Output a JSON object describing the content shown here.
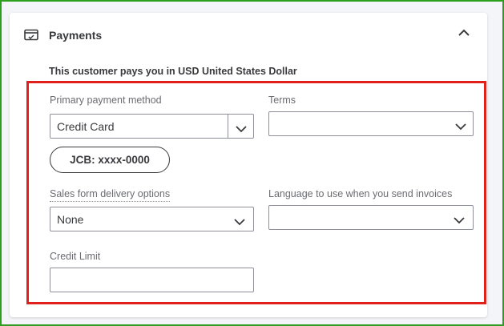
{
  "section": {
    "title": "Payments",
    "icon": "payment-card-icon",
    "collapse_icon": "chevron-up-icon"
  },
  "currency_note": "This customer pays you in USD United States Dollar",
  "fields": {
    "primary_payment_method": {
      "label": "Primary payment method",
      "value": "Credit Card"
    },
    "terms": {
      "label": "Terms",
      "value": ""
    },
    "saved_card": {
      "label": "JCB: xxxx-0000"
    },
    "sales_form_delivery": {
      "label": "Sales form delivery options",
      "value": "None"
    },
    "invoice_language": {
      "label": "Language to use when you send invoices",
      "value": ""
    },
    "credit_limit": {
      "label": "Credit Limit",
      "value": ""
    }
  },
  "colors": {
    "frame_border": "#2ca01c",
    "highlight_border": "#e0201b",
    "text": "#393a3d",
    "label": "#6b6c72"
  }
}
